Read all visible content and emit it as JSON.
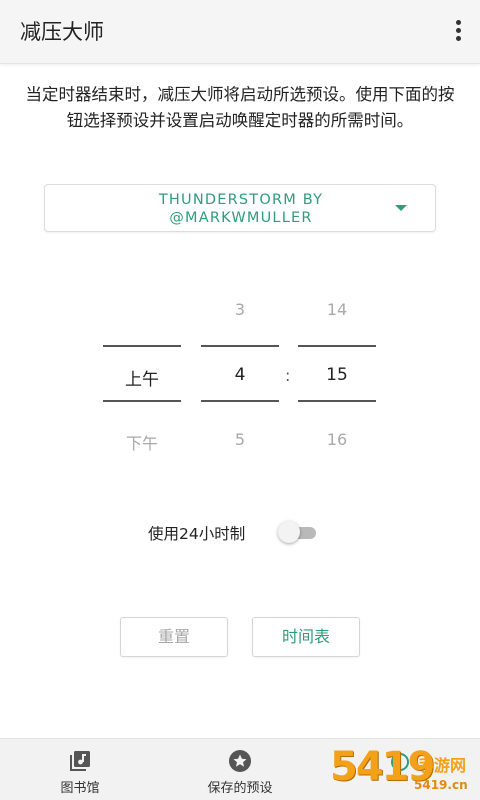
{
  "appbar": {
    "title": "减压大师",
    "menu_icon": "more-vert-icon"
  },
  "description": "当定时器结束时，减压大师将启动所选预设。使用下面的按钮选择预设并设置启动唤醒定时器的所需时间。",
  "preset": {
    "selected": "THUNDERSTORM BY @MARKWMULLER",
    "accent": "#2e9d78",
    "icon": "chevron-down-icon"
  },
  "time_picker": {
    "ampm": {
      "above": "",
      "selected": "上午",
      "below": "下午"
    },
    "hour": {
      "above": "3",
      "selected": "4",
      "below": "5"
    },
    "separator": ":",
    "minute": {
      "above": "14",
      "selected": "15",
      "below": "16"
    }
  },
  "toggle_24h": {
    "label": "使用24小时制",
    "enabled": false
  },
  "buttons": {
    "reset": "重置",
    "schedule": "时间表"
  },
  "bottom_nav": {
    "items": [
      {
        "label": "图书馆",
        "icon": "library-music-icon"
      },
      {
        "label": "保存的预设",
        "icon": "star-icon"
      },
      {
        "label": "",
        "icon": "timer-icon"
      }
    ]
  },
  "watermark": {
    "number": "5419",
    "text": "手游网",
    "url": "5419.cn"
  }
}
